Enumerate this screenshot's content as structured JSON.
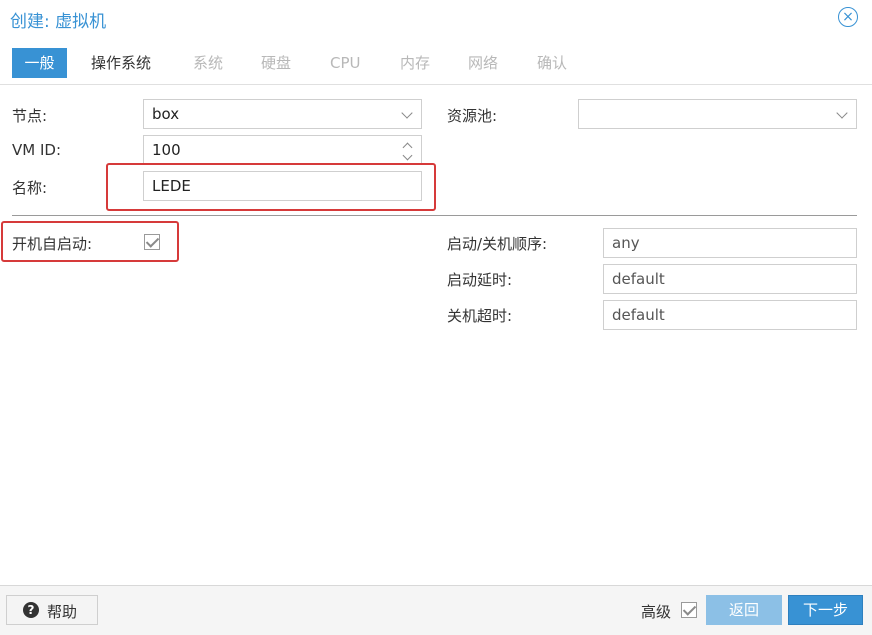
{
  "window": {
    "title": "创建: 虚拟机",
    "close_icon": "close-icon"
  },
  "tabs": [
    {
      "label": "一般",
      "state": "active"
    },
    {
      "label": "操作系统",
      "state": "enabled"
    },
    {
      "label": "系统",
      "state": "disabled"
    },
    {
      "label": "硬盘",
      "state": "disabled"
    },
    {
      "label": "CPU",
      "state": "disabled"
    },
    {
      "label": "内存",
      "state": "disabled"
    },
    {
      "label": "网络",
      "state": "disabled"
    },
    {
      "label": "确认",
      "state": "disabled"
    }
  ],
  "form": {
    "node": {
      "label": "节点:",
      "value": "box"
    },
    "pool": {
      "label": "资源池:",
      "value": ""
    },
    "vmid": {
      "label": "VM ID:",
      "value": "100"
    },
    "name": {
      "label": "名称:",
      "value": "LEDE"
    },
    "onboot": {
      "label": "开机自启动:",
      "checked": true
    },
    "startup_order": {
      "label": "启动/关机顺序:",
      "placeholder": "any"
    },
    "startup_delay": {
      "label": "启动延时:",
      "placeholder": "default"
    },
    "shutdown_timeout": {
      "label": "关机超时:",
      "placeholder": "default"
    }
  },
  "footer": {
    "help_label": "帮助",
    "advanced_label": "高级",
    "advanced_checked": true,
    "back_label": "返回",
    "next_label": "下一步"
  },
  "colors": {
    "accent": "#3892d4",
    "accent_disabled": "#8cc0e6",
    "highlight_box": "#d63a3a"
  }
}
